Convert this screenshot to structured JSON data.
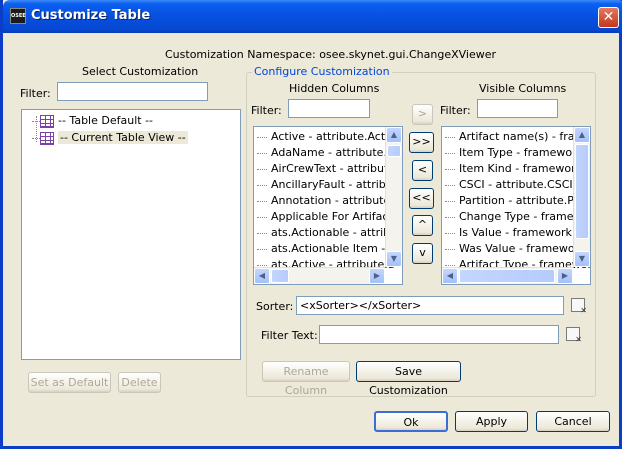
{
  "window": {
    "title": "Customize Table",
    "app_icon": "OSEE",
    "close_glyph": "✕"
  },
  "namespace_label": "Customization Namespace: osee.skynet.gui.ChangeXViewer",
  "select_customization": {
    "heading": "Select Customization",
    "filter_label": "Filter:",
    "filter_value": "",
    "items": [
      {
        "label": "-- Table Default --",
        "icon": "table-grid-icon"
      },
      {
        "label": "-- Current Table View --",
        "icon": "table-grid-icon",
        "selected": true
      }
    ],
    "set_default_label": "Set as Default",
    "delete_label": "Delete"
  },
  "configure": {
    "title": "Configure Customization",
    "hidden": {
      "heading": "Hidden Columns",
      "filter_label": "Filter:",
      "filter_value": "",
      "items": [
        "Active - attribute.Active",
        "AdaName - attribute.AdaName",
        "AirCrewText - attribute",
        "AncillaryFault - attribute",
        "Annotation - attribute",
        "Applicable For Artifact",
        "ats.Actionable - attribute",
        "ats.Actionable Item - a",
        "ats.Active - attribute.a"
      ]
    },
    "visible": {
      "heading": "Visible Columns",
      "filter_label": "Filter:",
      "filter_value": "",
      "items": [
        "Artifact name(s) - framework",
        "Item Type - framework",
        "Item Kind - framework",
        "CSCI - attribute.CSCI",
        "Partition - attribute.Pa",
        "Change Type - framework",
        "Is Value - framework.c",
        "Was Value - framework",
        "Artifact Type - framework"
      ]
    },
    "move_buttons": {
      "add": ">",
      "add_all": ">>",
      "remove": "<",
      "remove_all": "<<",
      "up": "^",
      "down": "v"
    },
    "sorter_label": "Sorter:",
    "sorter_value": "<xSorter></xSorter>",
    "filter_text_label": "Filter Text:",
    "filter_text_value": "",
    "rename_label": "Rename Column",
    "save_label": "Save Customization"
  },
  "footer": {
    "ok_label": "Ok",
    "apply_label": "Apply",
    "cancel_label": "Cancel"
  },
  "colors": {
    "title_bar": "#0750df",
    "dialog_bg": "#ece9d8",
    "group_title": "#0046d5",
    "selection": "#ece9d8"
  }
}
